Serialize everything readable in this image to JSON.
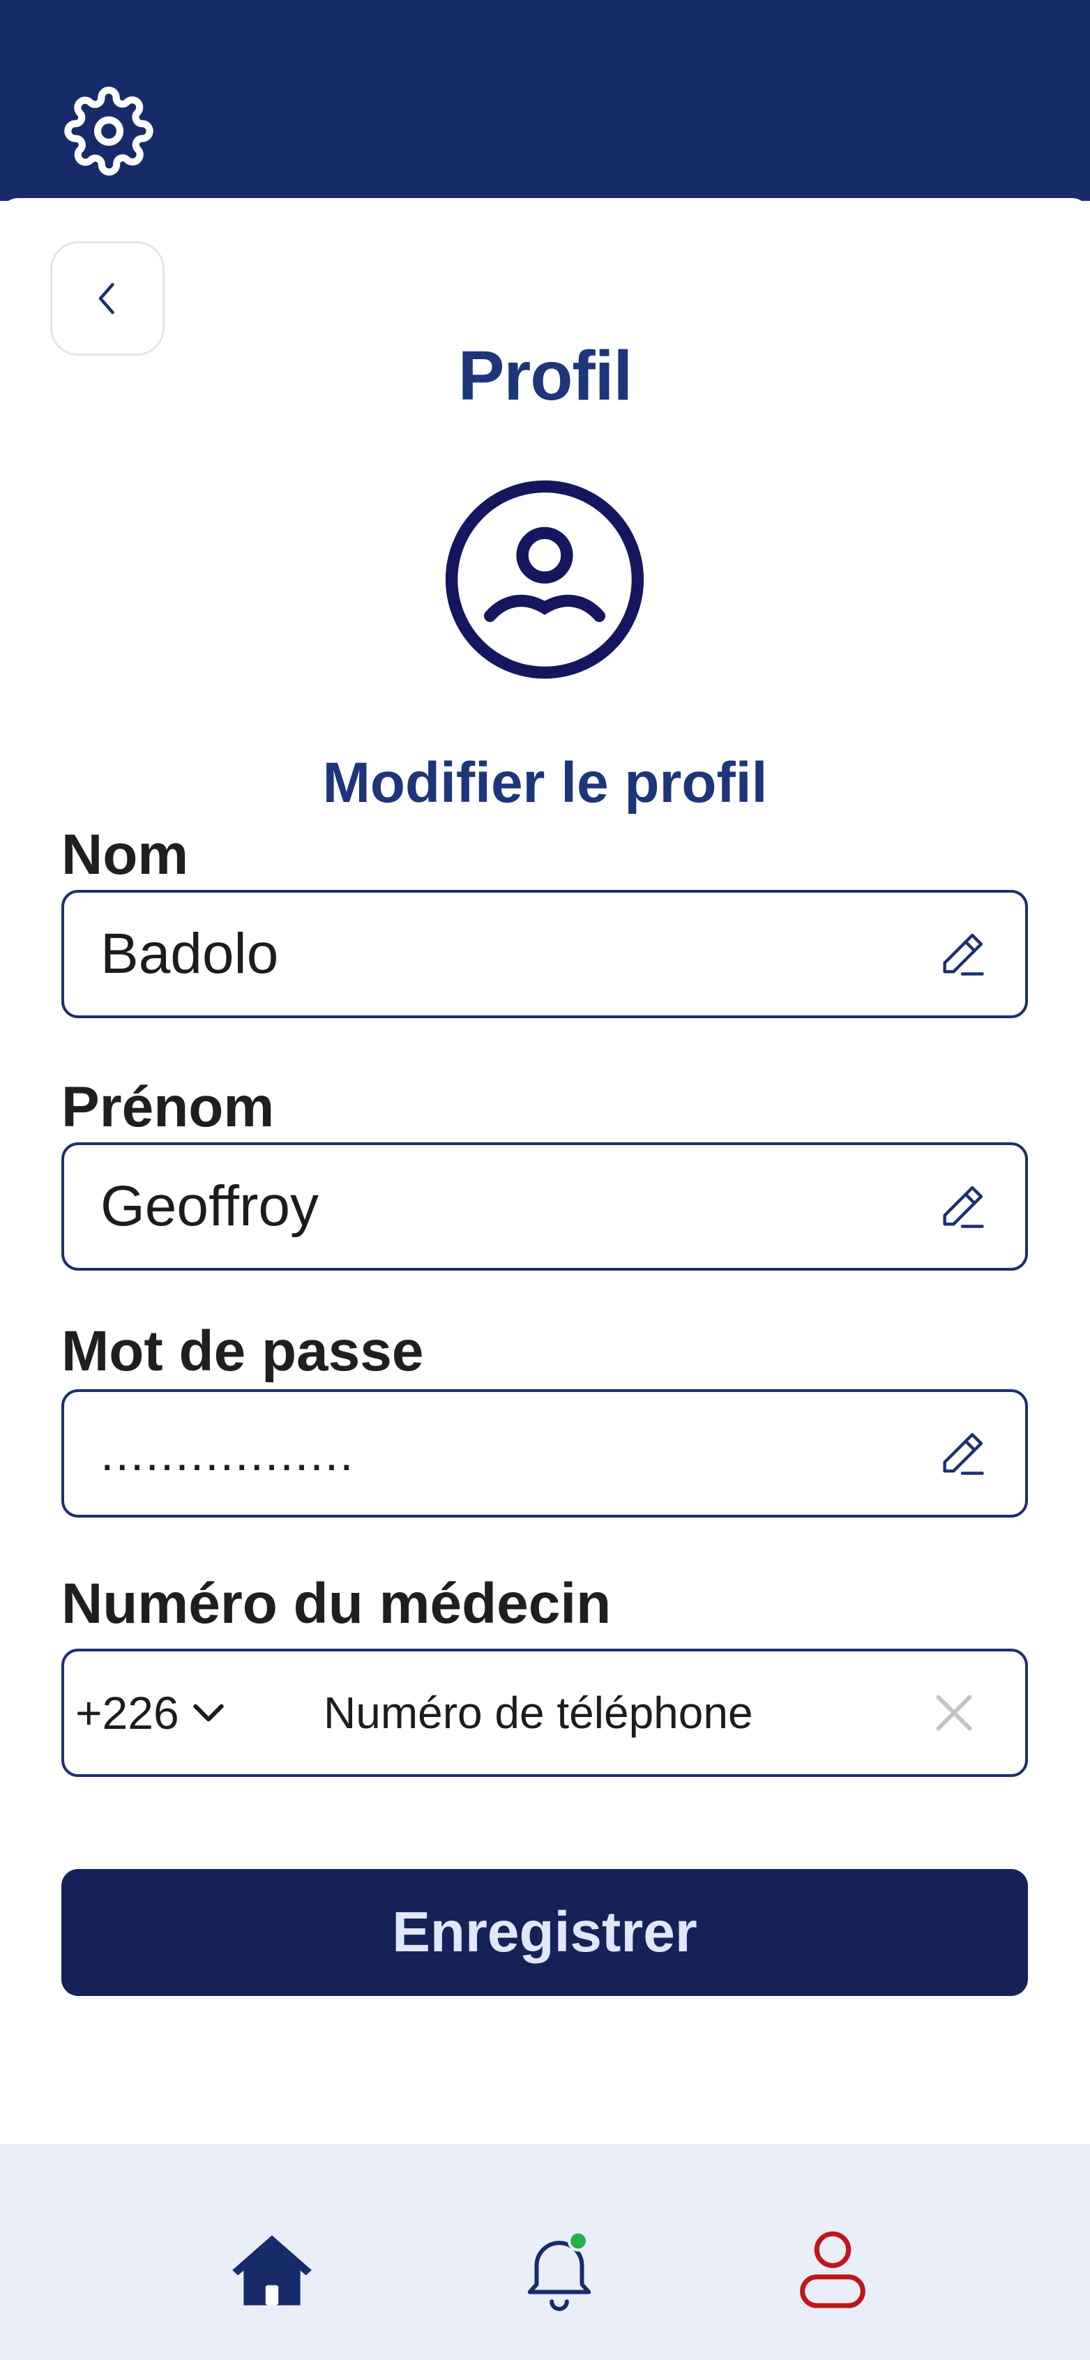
{
  "header": {
    "settings_icon": "gear-icon"
  },
  "page": {
    "back_icon": "chevron-left-icon",
    "title": "Profil",
    "avatar_icon": "user-circle-icon",
    "section_title": "Modifier le profil"
  },
  "form": {
    "nom": {
      "label": "Nom",
      "value": "Badolo"
    },
    "prenom": {
      "label": "Prénom",
      "value": "Geoffroy"
    },
    "password": {
      "label": "Mot de passe",
      "value": "................."
    },
    "doctor_phone": {
      "label": "Numéro du médecin",
      "country_code": "+226",
      "placeholder": "Numéro de téléphone",
      "value": ""
    },
    "save_label": "Enregistrer"
  },
  "bottom_nav": {
    "items": [
      {
        "name": "home",
        "icon": "home-icon",
        "active": true
      },
      {
        "name": "notifications",
        "icon": "bell-icon",
        "badge": true
      },
      {
        "name": "profile",
        "icon": "user-icon"
      }
    ]
  },
  "colors": {
    "primary": "#172b6b",
    "title": "#1d3679",
    "button": "#142258",
    "nav_bg": "#e9eef8",
    "profile_accent": "#c0161b",
    "badge": "#22b14c"
  }
}
